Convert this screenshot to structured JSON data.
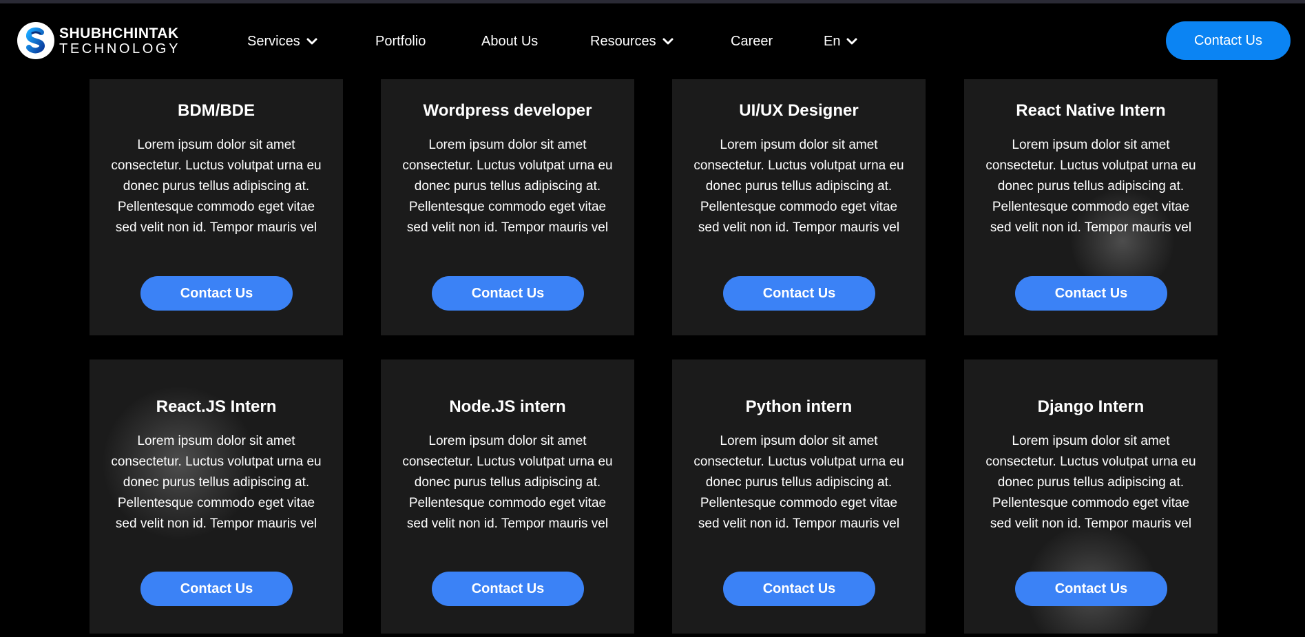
{
  "brand": {
    "name_line1": "SHUBHCHINTAK",
    "name_line2": "TECHNOLOGY",
    "logo_letter": "S",
    "accent": "#0b84f3"
  },
  "nav": {
    "items": [
      {
        "label": "Services",
        "dropdown": true
      },
      {
        "label": "Portfolio",
        "dropdown": false
      },
      {
        "label": "About Us",
        "dropdown": false
      },
      {
        "label": "Resources",
        "dropdown": true
      },
      {
        "label": "Career",
        "dropdown": false
      },
      {
        "label": "En",
        "dropdown": true
      }
    ],
    "cta_label": "Contact Us"
  },
  "colors": {
    "background": "#000000",
    "card": "#1b1b1b",
    "button": "#3b82f6",
    "header_button": "#0b84f3"
  },
  "jobs": [
    {
      "title": "BDM/BDE",
      "description": "Lorem ipsum dolor sit amet consectetur. Luctus volutpat urna eu donec purus tellus adipiscing at. Pellentesque commodo eget vitae sed velit non id. Tempor mauris vel",
      "button": "Contact Us"
    },
    {
      "title": "Wordpress developer",
      "description": "Lorem ipsum dolor sit amet consectetur. Luctus volutpat urna eu donec purus tellus adipiscing at. Pellentesque commodo eget vitae sed velit non id. Tempor mauris vel",
      "button": "Contact Us"
    },
    {
      "title": "UI/UX Designer",
      "description": "Lorem ipsum dolor sit amet consectetur. Luctus volutpat urna eu donec purus tellus adipiscing at. Pellentesque commodo eget vitae sed velit non id. Tempor mauris vel",
      "button": "Contact Us"
    },
    {
      "title": "React Native Intern",
      "description": "Lorem ipsum dolor sit amet consectetur. Luctus volutpat urna eu donec purus tellus adipiscing at. Pellentesque commodo eget vitae sed velit non id. Tempor mauris vel",
      "button": "Contact Us"
    },
    {
      "title": "React.JS Intern",
      "description": "Lorem ipsum dolor sit amet consectetur. Luctus volutpat urna eu donec purus tellus adipiscing at. Pellentesque commodo eget vitae sed velit non id. Tempor mauris vel",
      "button": "Contact Us"
    },
    {
      "title": "Node.JS intern",
      "description": "Lorem ipsum dolor sit amet consectetur. Luctus volutpat urna eu donec purus tellus adipiscing at. Pellentesque commodo eget vitae sed velit non id. Tempor mauris vel",
      "button": "Contact Us"
    },
    {
      "title": "Python intern",
      "description": "Lorem ipsum dolor sit amet consectetur. Luctus volutpat urna eu donec purus tellus adipiscing at. Pellentesque commodo eget vitae sed velit non id. Tempor mauris vel",
      "button": "Contact Us"
    },
    {
      "title": "Django Intern",
      "description": "Lorem ipsum dolor sit amet consectetur. Luctus volutpat urna eu donec purus tellus adipiscing at. Pellentesque commodo eget vitae sed velit non id. Tempor mauris vel",
      "button": "Contact Us"
    }
  ]
}
